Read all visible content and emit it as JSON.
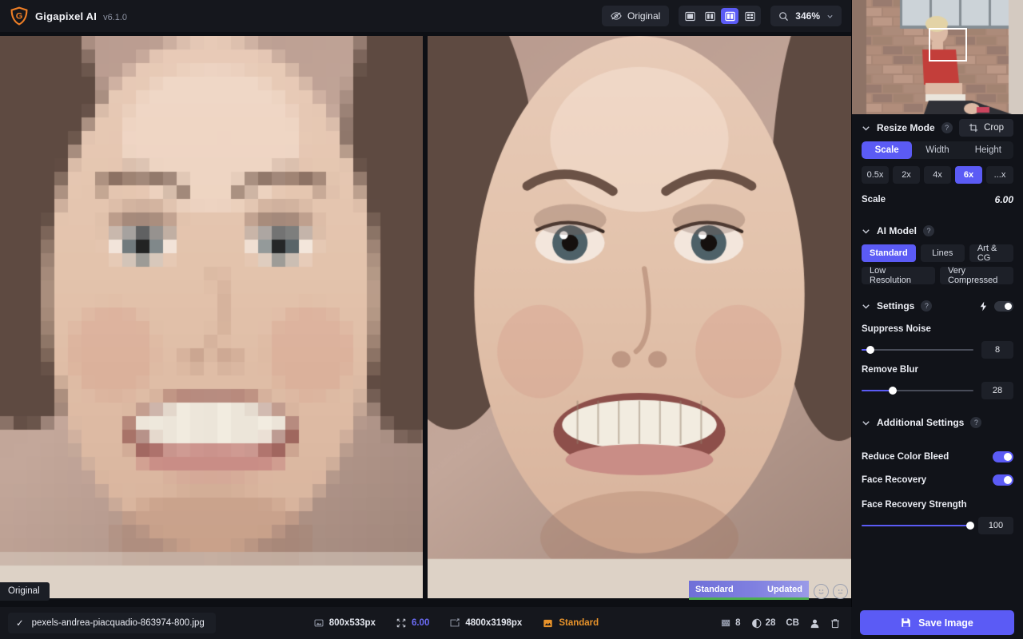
{
  "app": {
    "name": "Gigapixel AI",
    "version": "v6.1.0",
    "logo_icon": "gigapixel-shield-logo"
  },
  "toolbar": {
    "original_toggle": {
      "label": "Original",
      "icon": "eye-off-icon"
    },
    "view_modes": [
      {
        "name": "single-view",
        "icon": "single-pane-icon",
        "selected": false
      },
      {
        "name": "split-view",
        "icon": "two-pane-icon",
        "selected": false
      },
      {
        "name": "side-by-side-view",
        "icon": "side-by-side-icon",
        "selected": true
      },
      {
        "name": "grid-view",
        "icon": "quad-pane-icon",
        "selected": false
      }
    ],
    "zoom": {
      "icon": "magnifier-icon",
      "value": "346%",
      "chevron": "chevron-down-icon"
    }
  },
  "canvas": {
    "left_pane_label": "Original",
    "right_pane_badge": {
      "model": "Standard",
      "status": "Updated"
    },
    "feedback_icons": [
      {
        "name": "smiley-happy-icon"
      },
      {
        "name": "smiley-neutral-icon"
      }
    ]
  },
  "navigator": {
    "name": "image-navigator-thumbnail",
    "viewport_rect": true
  },
  "panel": {
    "resize_mode": {
      "title": "Resize Mode",
      "help": "?",
      "crop_button": {
        "label": "Crop",
        "icon": "crop-icon"
      },
      "tabs": [
        {
          "label": "Scale",
          "selected": true
        },
        {
          "label": "Width",
          "selected": false
        },
        {
          "label": "Height",
          "selected": false
        }
      ],
      "presets": [
        {
          "label": "0.5x",
          "selected": false
        },
        {
          "label": "2x",
          "selected": false
        },
        {
          "label": "4x",
          "selected": false
        },
        {
          "label": "6x",
          "selected": true
        },
        {
          "label": "...x",
          "selected": false
        }
      ],
      "scale_label": "Scale",
      "scale_value": "6.00"
    },
    "ai_model": {
      "title": "AI Model",
      "help": "?",
      "row1": [
        {
          "label": "Standard",
          "selected": true
        },
        {
          "label": "Lines",
          "selected": false
        },
        {
          "label": "Art & CG",
          "selected": false
        }
      ],
      "row2": [
        {
          "label": "Low Resolution",
          "selected": false
        },
        {
          "label": "Very Compressed",
          "selected": false
        }
      ]
    },
    "settings": {
      "title": "Settings",
      "help": "?",
      "auto_icon": "lightning-bolt-icon",
      "auto_toggle_on": false,
      "sliders": [
        {
          "label": "Suppress Noise",
          "value": "8",
          "percent": 8
        },
        {
          "label": "Remove Blur",
          "value": "28",
          "percent": 28
        }
      ]
    },
    "additional_settings": {
      "title": "Additional Settings",
      "help": "?",
      "toggles": [
        {
          "label": "Reduce Color Bleed",
          "on": true
        },
        {
          "label": "Face Recovery",
          "on": true
        }
      ],
      "strength": {
        "label": "Face Recovery Strength",
        "value": "100",
        "percent": 100
      }
    }
  },
  "statusbar": {
    "file": {
      "check": "✓",
      "name": "pexels-andrea-piacquadio-863974-800.jpg"
    },
    "input_size": {
      "icon": "image-in-icon",
      "text": "800x533px"
    },
    "scale": {
      "icon": "resize-arrows-icon",
      "text": "6.00"
    },
    "output_size": {
      "icon": "image-out-icon",
      "text": "4800x3198px"
    },
    "model": {
      "icon": "model-chip-icon",
      "text": "Standard"
    },
    "stats": [
      {
        "icon": "noise-grid-icon",
        "text": "8"
      },
      {
        "icon": "blur-half-icon",
        "text": "28"
      },
      {
        "icon": "color-bleed-icon",
        "text": "CB"
      },
      {
        "icon": "face-recovery-icon",
        "text": ""
      },
      {
        "icon": "trash-icon",
        "text": ""
      }
    ],
    "save_button": {
      "label": "Save Image",
      "icon": "floppy-save-icon"
    }
  },
  "colors": {
    "accent": "#5b5bf5",
    "orange": "#e8932b",
    "green": "#4caf50",
    "panel_bg": "#111319",
    "bar_bg": "#15171d"
  }
}
